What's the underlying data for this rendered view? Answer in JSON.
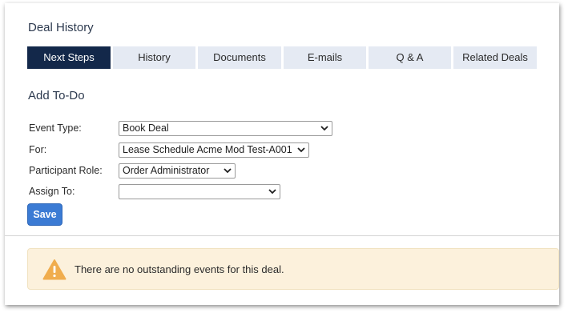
{
  "section_title": "Deal History",
  "tabs": [
    {
      "label": "Next Steps",
      "active": true
    },
    {
      "label": "History",
      "active": false
    },
    {
      "label": "Documents",
      "active": false
    },
    {
      "label": "E-mails",
      "active": false
    },
    {
      "label": "Q & A",
      "active": false
    },
    {
      "label": "Related Deals",
      "active": false
    }
  ],
  "add_todo": {
    "title": "Add To-Do",
    "event_type": {
      "label": "Event Type:",
      "value": "Book Deal"
    },
    "for": {
      "label": "For:",
      "value": "Lease Schedule Acme Mod Test-A001"
    },
    "participant_role": {
      "label": "Participant Role:",
      "value": "Order Administrator"
    },
    "assign_to": {
      "label": "Assign To:",
      "value": ""
    },
    "save_label": "Save"
  },
  "alert": {
    "icon": "warning-icon",
    "message": "There are no outstanding events for this deal.",
    "colors": {
      "background": "#fcf1dc",
      "icon": "#f0ad4e"
    }
  },
  "colors": {
    "active_tab": "#13284a",
    "inactive_tab": "#e5eaf3",
    "save_button": "#3b7bd4"
  }
}
